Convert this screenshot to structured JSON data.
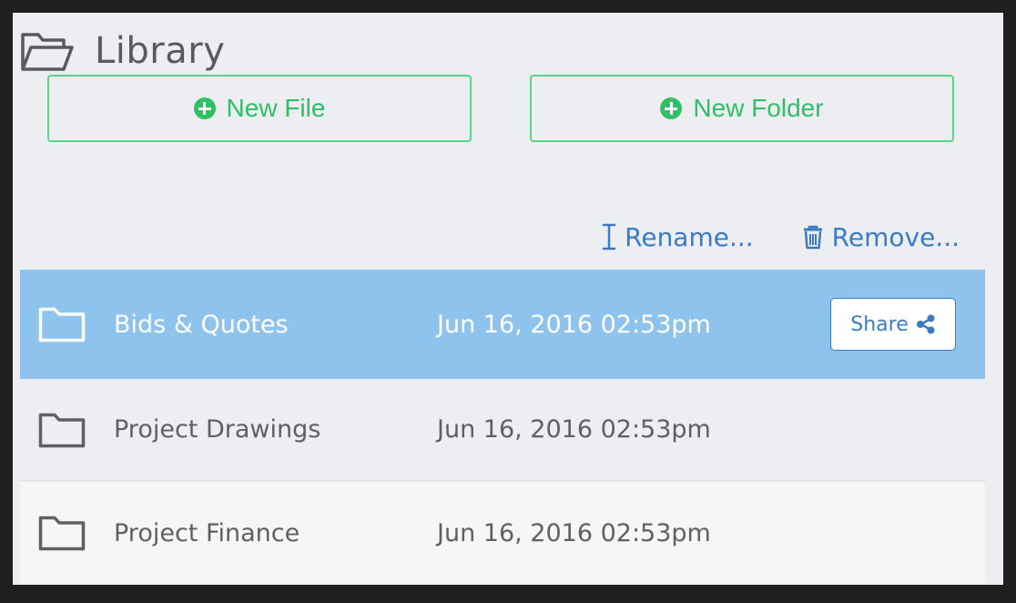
{
  "library": {
    "title": "Library",
    "icon": "folder-open-icon"
  },
  "buttons": {
    "new_file": "New File",
    "new_folder": "New Folder",
    "icon": "plus-circle-icon"
  },
  "actions": {
    "rename": "Rename...",
    "rename_icon": "text-cursor-icon",
    "remove": "Remove...",
    "remove_icon": "trash-icon"
  },
  "files": [
    {
      "name": "Bids & Quotes",
      "date": "Jun 16, 2016 02:53pm",
      "selected": true,
      "icon": "folder-icon"
    },
    {
      "name": "Project Drawings",
      "date": "Jun 16, 2016 02:53pm",
      "selected": false,
      "icon": "folder-icon"
    },
    {
      "name": "Project Finance",
      "date": "Jun 16, 2016 02:53pm",
      "selected": false,
      "icon": "folder-icon"
    }
  ],
  "share": {
    "label": "Share",
    "icon": "share-icon"
  },
  "colors": {
    "accent_green": "#2fc066",
    "accent_blue": "#3a7cc4",
    "selected_row": "#8dc3ec"
  }
}
